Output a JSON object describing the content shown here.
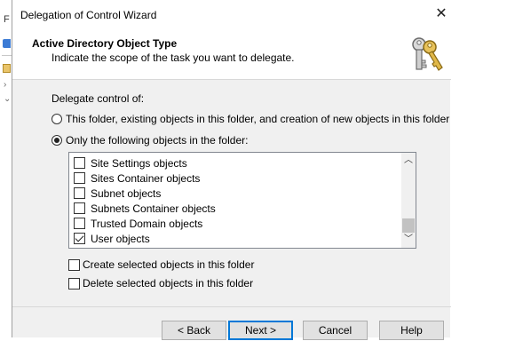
{
  "background": {
    "letter": "F"
  },
  "wizard": {
    "title": "Delegation of Control Wizard",
    "close_glyph": "✕",
    "header": {
      "title": "Active Directory Object Type",
      "subtitle": "Indicate the scope of the task you want to delegate.",
      "icon": "keys-icon"
    },
    "delegate_label": "Delegate control of:",
    "radios": [
      {
        "label": "This folder, existing objects in this folder, and creation of new objects in this folder",
        "checked": false
      },
      {
        "label": "Only the following objects in the folder:",
        "checked": true
      }
    ],
    "object_list": [
      {
        "label": "Site Settings objects",
        "checked": false
      },
      {
        "label": "Sites Container objects",
        "checked": false
      },
      {
        "label": "Subnet objects",
        "checked": false
      },
      {
        "label": "Subnets Container objects",
        "checked": false
      },
      {
        "label": "Trusted Domain objects",
        "checked": false
      },
      {
        "label": "User objects",
        "checked": true
      }
    ],
    "scroll": {
      "up_glyph": "︿",
      "down_glyph": "﹀"
    },
    "options": [
      {
        "label": "Create selected objects in this folder",
        "checked": false
      },
      {
        "label": "Delete selected objects in this folder",
        "checked": false
      }
    ],
    "buttons": {
      "back": "< Back",
      "next": "Next >",
      "cancel": "Cancel",
      "help": "Help"
    }
  },
  "colors": {
    "dialog_bg": "#f0f0f0",
    "header_bg": "#ffffff",
    "default_button_border": "#0078d7"
  }
}
